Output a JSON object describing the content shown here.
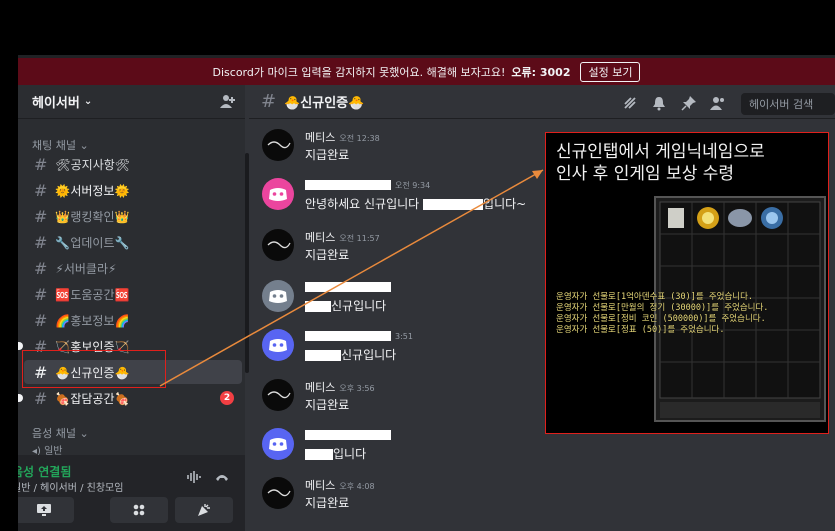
{
  "banner": {
    "message": "Discord가 마이크 입력을 감지하지 못했어요. 해결해 보자고요!",
    "error_label": "오류: 3002",
    "button": "설정 보기"
  },
  "server": {
    "name": "헤이서버"
  },
  "sidebar": {
    "text_category": "채팅 채널",
    "voice_category": "음성 채널",
    "voice_partial": "일반",
    "channels": [
      {
        "name": "🛠공지사항🛠"
      },
      {
        "name": "🌞서버정보🌞"
      },
      {
        "name": "👑랭킹확인👑"
      },
      {
        "name": "🔧업데이트🔧"
      },
      {
        "name": "⚡서버클라⚡"
      },
      {
        "name": "🆘도움공간🆘"
      },
      {
        "name": "🌈홍보정보🌈"
      },
      {
        "name": "🏹홍보인증🏹"
      },
      {
        "name": "🐣신규인증🐣"
      },
      {
        "name": "🍖잡담공간🍖",
        "badge": "2"
      }
    ]
  },
  "voice_panel": {
    "status": "음성 연결됨",
    "location": "일반 / 헤이서버 / 친창모임"
  },
  "chat": {
    "channel": "🐣신규인증🐣",
    "search_placeholder": "헤이서버 검색",
    "messages": [
      {
        "user": "메티스",
        "time": "오전 12:38",
        "text": "지급완료"
      },
      {
        "user": "",
        "time": "오전 9:34",
        "text_a": "안녕하세요 신규입니다",
        "text_b": "입니다~"
      },
      {
        "user": "메티스",
        "time": "오전 11:57",
        "text": "지급완료"
      },
      {
        "user": "",
        "time": "",
        "text": "신규입니다"
      },
      {
        "user": "",
        "time": "3:51",
        "text": "신규입니다"
      },
      {
        "user": "메티스",
        "time": "오후 3:56",
        "text": "지급완료"
      },
      {
        "user": "",
        "time": "",
        "text": "입니다"
      },
      {
        "user": "메티스",
        "time": "오후 4:08",
        "text": "지급완료"
      }
    ]
  },
  "annotation": {
    "text": "신규인탭에서 게임닉네임으로\n인사 후 인게임 보상 수령",
    "game_log": [
      "운영자가 선물로[1억아덴수표 (30)]를 주었습니다.",
      "운영자가 선물로[만월의 정기 (30000)]를 주었습니다.",
      "운영자가 선물로[정비 코인 (500000)]를 주었습니다.",
      "운영자가 선물로[정표 (50)]를 주었습니다."
    ]
  },
  "colors": {
    "accent_red": "#e0201c",
    "arrow": "#e98a3c",
    "banner_bg": "#5c0b18",
    "voice_green": "#23a55a"
  }
}
